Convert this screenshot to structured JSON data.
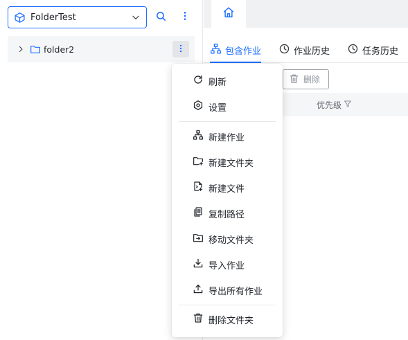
{
  "sidebar": {
    "project_value": "FolderTest",
    "tree": [
      {
        "label": "folder2"
      }
    ]
  },
  "tabs": {
    "home_icon": "home-icon"
  },
  "subtabs": [
    {
      "label": "包含作业",
      "icon": "workflow-icon",
      "active": true
    },
    {
      "label": "作业历史",
      "icon": "history-icon",
      "active": false
    },
    {
      "label": "任务历史",
      "icon": "history-icon",
      "active": false
    }
  ],
  "toolbar": {
    "delete_label": "删除"
  },
  "table": {
    "columns": [
      "优先级"
    ]
  },
  "context_menu": {
    "items": [
      {
        "label": "刷新",
        "icon": "refresh-icon"
      },
      {
        "label": "设置",
        "icon": "settings-icon"
      },
      {
        "label": "新建作业",
        "icon": "new-job-icon"
      },
      {
        "label": "新建文件夹",
        "icon": "new-folder-icon"
      },
      {
        "label": "新建文件",
        "icon": "new-file-icon"
      },
      {
        "label": "复制路径",
        "icon": "copy-path-icon"
      },
      {
        "label": "移动文件夹",
        "icon": "move-folder-icon"
      },
      {
        "label": "导入作业",
        "icon": "import-icon"
      },
      {
        "label": "导出所有作业",
        "icon": "export-icon"
      },
      {
        "label": "删除文件夹",
        "icon": "delete-folder-icon"
      }
    ]
  },
  "colors": {
    "accent": "#1e6fff",
    "text": "#1f2329",
    "muted": "#8f959e"
  }
}
